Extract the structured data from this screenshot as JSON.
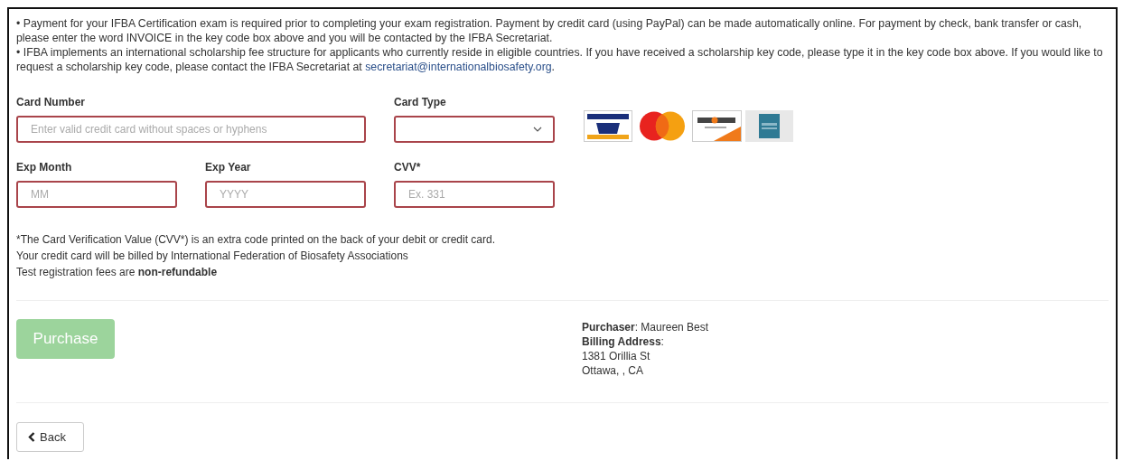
{
  "notes": [
    {
      "text": "•   Payment for your IFBA Certification exam is required prior to completing your exam registration. Payment by credit card (using PayPal) can be made automatically online. For payment by check, bank transfer or cash, please enter the word INVOICE in the key code box above and you will be contacted by the IFBA Secretariat."
    },
    {
      "text": "•   IFBA implements an international scholarship fee structure for applicants who currently reside in eligible countries. If you have received a scholarship key code, please type it in the key code box above. If you would like to request a scholarship key code, please contact the IFBA Secretariat at ",
      "link": "secretariat@internationalbiosafety.org",
      "after": "."
    }
  ],
  "fields": [
    {
      "label": "Card Number",
      "kind": "text",
      "placeholder": "Enter valid credit card without spaces or hyphens",
      "invalid": true
    },
    {
      "label": "Card Type",
      "kind": "select",
      "invalid": true
    },
    {
      "label": "Exp Month",
      "kind": "text",
      "placeholder": "MM",
      "invalid": true
    },
    {
      "label": "Exp Year",
      "kind": "text",
      "placeholder": "YYYY",
      "invalid": true
    },
    {
      "label": "CVV*",
      "kind": "text",
      "placeholder": "Ex. 331",
      "invalid": true
    }
  ],
  "fine_print": [
    {
      "text": "*The Card Verification Value (CVV*) is an extra code printed on the back of your debit or credit card."
    },
    {
      "text": "Your credit card will be billed by International Federation of Biosafety Associations"
    },
    {
      "text": "Test registration fees are ",
      "bold": "non-refundable"
    }
  ],
  "purchase_button": {
    "label": "Purchase",
    "disabled": true
  },
  "purchaser": [
    "**Purchaser**: Maureen Best",
    "**Billing Address**:",
    "1381 Orillia St",
    "Ottawa, , CA"
  ],
  "back_button": {
    "label": "Back"
  }
}
